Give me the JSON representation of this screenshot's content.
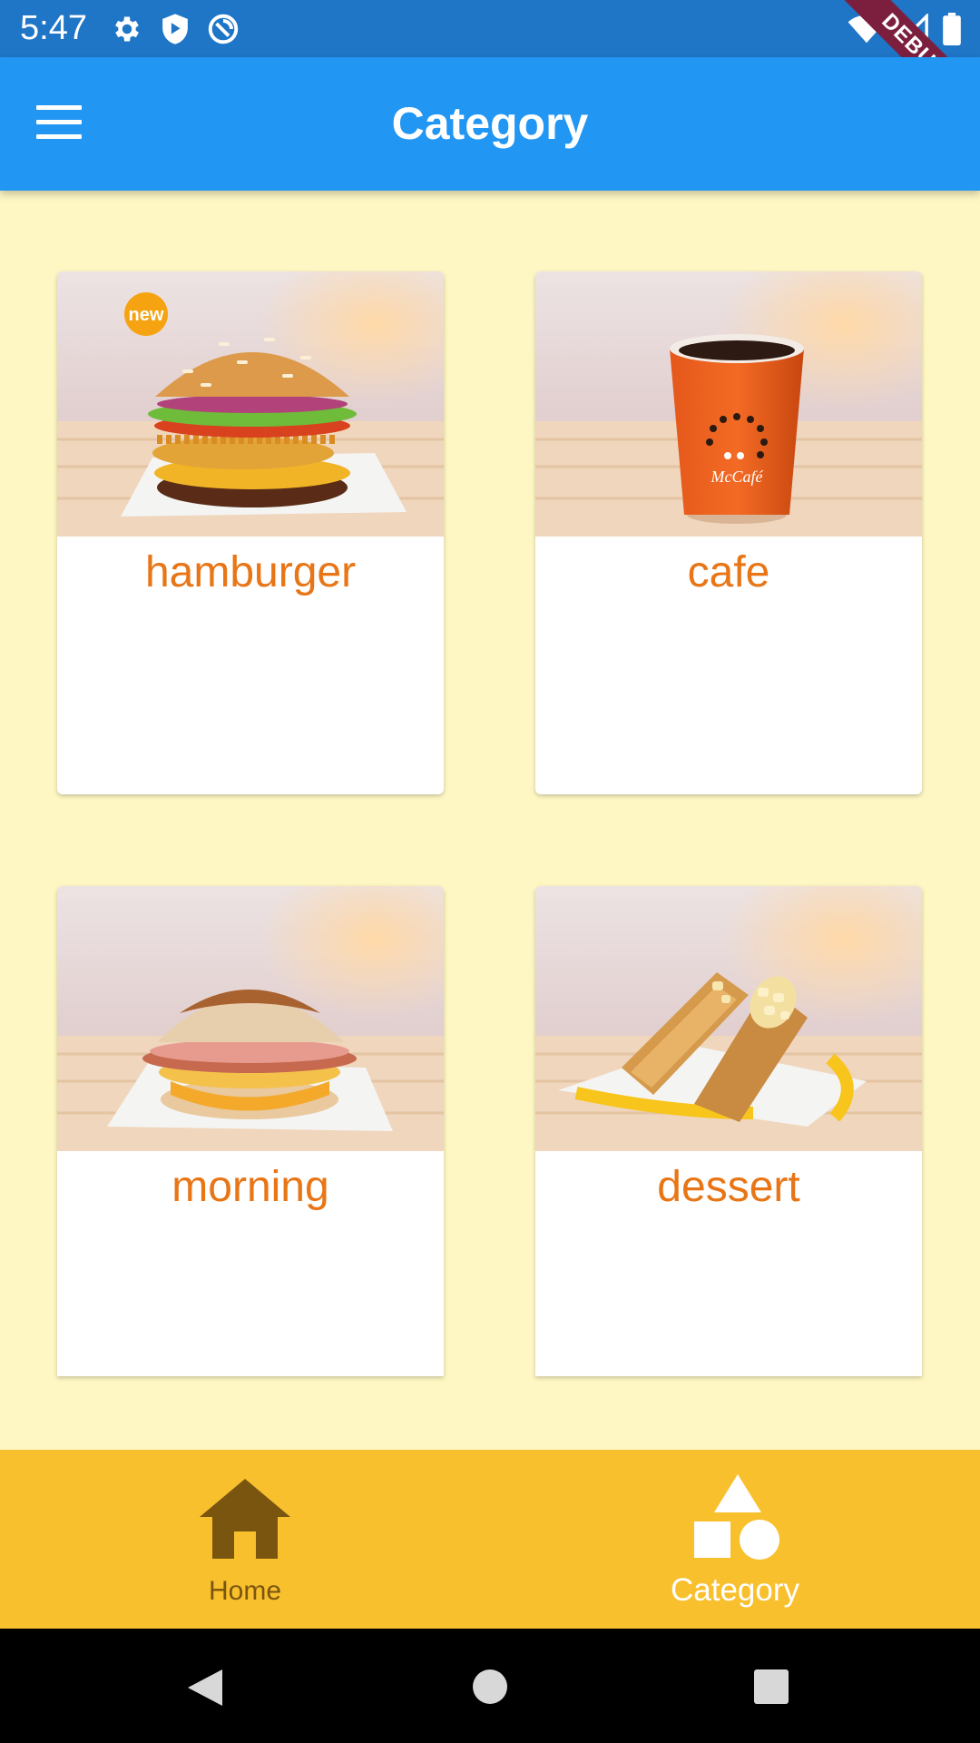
{
  "status_bar": {
    "time": "5:47",
    "left_icons": [
      "gear-icon",
      "shield-play-icon",
      "vpn-icon"
    ],
    "right_icons": [
      "wifi-icon",
      "cellular-signal-icon",
      "battery-icon"
    ],
    "debug_banner": "DEBUG"
  },
  "app_bar": {
    "title": "Category",
    "menu_icon": "hamburger-menu-icon",
    "color": "#2196f3"
  },
  "categories": [
    {
      "label": "hamburger",
      "image": "burger-photo",
      "badge": "new"
    },
    {
      "label": "cafe",
      "image": "mccafe-cup-photo",
      "cup_text": "McCafé"
    },
    {
      "label": "morning",
      "image": "breakfast-muffin-photo"
    },
    {
      "label": "dessert",
      "image": "apple-pie-photo"
    }
  ],
  "bottom_nav": {
    "items": [
      {
        "label": "Home",
        "icon": "home-icon",
        "selected": false
      },
      {
        "label": "Category",
        "icon": "shapes-icon",
        "selected": true
      }
    ],
    "background": "#f9c02d"
  },
  "system_nav": [
    "back-icon",
    "home-circle-icon",
    "recents-icon"
  ],
  "colors": {
    "page_background": "#fef7c3",
    "label_color": "#e87516",
    "nav_unselected": "#7a5510",
    "nav_selected": "#ffffff"
  }
}
